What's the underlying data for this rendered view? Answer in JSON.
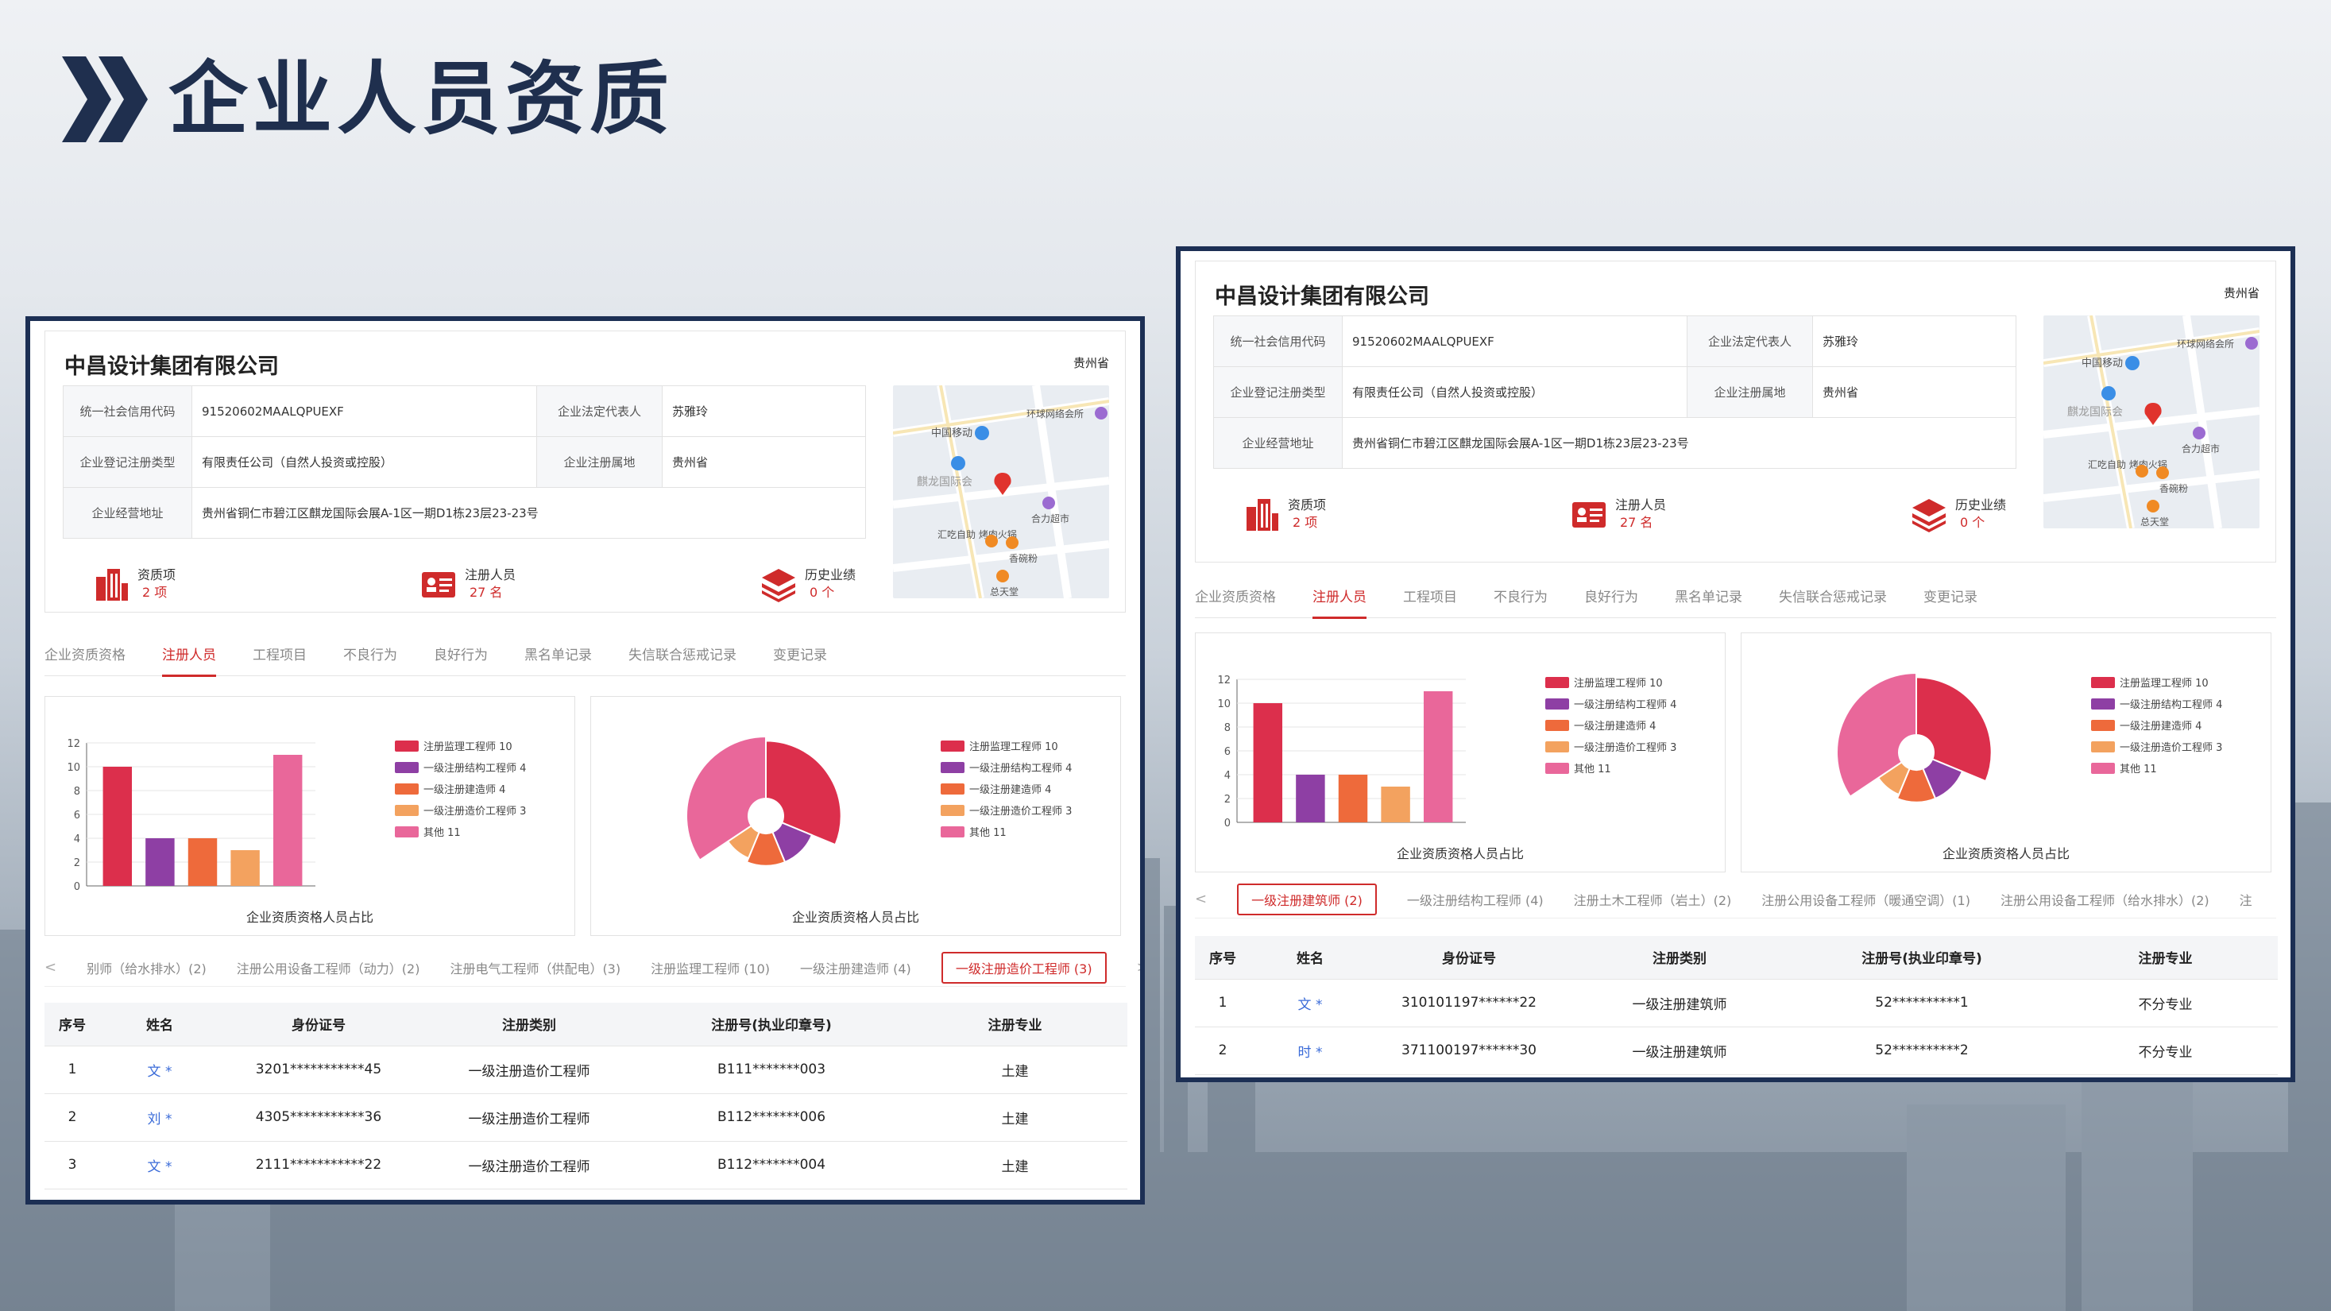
{
  "slide": {
    "title": "企业人员资质"
  },
  "company": {
    "name": "中昌设计集团有限公司",
    "province": "贵州省",
    "info": {
      "credit_code_label": "统一社会信用代码",
      "credit_code": "91520602MAALQPUEXF",
      "legal_rep_label": "企业法定代表人",
      "legal_rep": "苏雅玲",
      "reg_type_label": "企业登记注册类型",
      "reg_type": "有限责任公司（自然人投资或控股）",
      "reg_place_label": "企业注册属地",
      "reg_place": "贵州省",
      "address_label": "企业经营地址",
      "address": "贵州省铜仁市碧江区麒龙国际会展A-1区一期D1栋23层23-23号"
    },
    "stats": {
      "qual_label": "资质项",
      "qual_value": "2 项",
      "staff_label": "注册人员",
      "staff_value": "27 名",
      "history_label": "历史业绩",
      "history_value": "0 个"
    }
  },
  "map": {
    "label_cmcc": "中国移动",
    "label_ring": "环球网络会所",
    "label_qilong": "麒龙国际会",
    "label_hehe": "合力超市",
    "label_hotpot": "汇吃自助\n烤肉火锅",
    "label_bowl": "香碗粉",
    "label_total": "总天堂"
  },
  "tabs": [
    "企业资质资格",
    "注册人员",
    "工程项目",
    "不良行为",
    "良好行为",
    "黑名单记录",
    "失信联合惩戒记录",
    "变更记录"
  ],
  "chart_data": [
    {
      "type": "bar",
      "title": "",
      "caption": "企业资质资格人员占比",
      "categories": [
        "注册监理工程师",
        "一级注册结构工程师",
        "一级注册建造师",
        "一级注册造价工程师",
        "其他"
      ],
      "values": [
        10,
        4,
        4,
        3,
        11
      ],
      "ylim": [
        0,
        12
      ],
      "yticks": [
        0,
        2,
        4,
        6,
        8,
        10,
        12
      ],
      "colors": [
        "#dc2f4c",
        "#8e3fa4",
        "#ee6a3b",
        "#f3a25f",
        "#e9679a"
      ],
      "legend": [
        "注册监理工程师 10",
        "一级注册结构工程师 4",
        "一级注册建造师 4",
        "一级注册造价工程师 3",
        "其他 11"
      ]
    },
    {
      "type": "pie",
      "title": "",
      "caption": "企业资质资格人员占比",
      "categories": [
        "注册监理工程师",
        "一级注册结构工程师",
        "一级注册建造师",
        "一级注册造价工程师",
        "其他"
      ],
      "values": [
        10,
        4,
        4,
        3,
        11
      ],
      "colors": [
        "#dc2f4c",
        "#8e3fa4",
        "#ee6a3b",
        "#f3a25f",
        "#e9679a"
      ]
    }
  ],
  "shot1": {
    "subtabs": [
      "<",
      "别师（给水排水）(2)",
      "注册公用设备工程师（动力）(2)",
      "注册电气工程师（供配电）(3)",
      "注册监理工程师 (10)",
      "一级注册建造师 (4)",
      "一级注册造价工程师 (3)",
      ">"
    ],
    "headers": [
      "序号",
      "姓名",
      "身份证号",
      "注册类别",
      "注册号(执业印章号)",
      "注册专业"
    ],
    "rows": [
      [
        "1",
        "文 *",
        "3201***********45",
        "一级注册造价工程师",
        "B111*******003",
        "土建"
      ],
      [
        "2",
        "刘 *",
        "4305***********36",
        "一级注册造价工程师",
        "B112*******006",
        "土建"
      ],
      [
        "3",
        "文 *",
        "2111***********22",
        "一级注册造价工程师",
        "B112*******004",
        "土建"
      ]
    ]
  },
  "shot2": {
    "subtabs": [
      "<",
      "一级注册建筑师 (2)",
      "一级注册结构工程师 (4)",
      "注册土木工程师（岩土）(2)",
      "注册公用设备工程师（暖通空调）(1)",
      "注册公用设备工程师（给水排水）(2)",
      "注"
    ],
    "headers": [
      "序号",
      "姓名",
      "身份证号",
      "注册类别",
      "注册号(执业印章号)",
      "注册专业"
    ],
    "rows": [
      [
        "1",
        "文 *",
        "310101197******22",
        "一级注册建筑师",
        "52**********1",
        "不分专业"
      ],
      [
        "2",
        "时 *",
        "371100197******30",
        "一级注册建筑师",
        "52**********2",
        "不分专业"
      ]
    ]
  }
}
